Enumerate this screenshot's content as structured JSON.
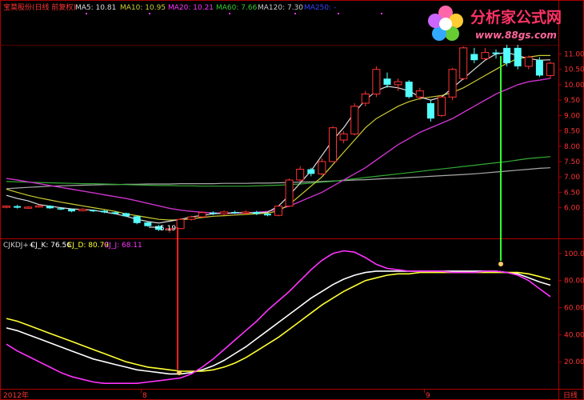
{
  "header": {
    "stock": "宝莫股份(日线 前复权)",
    "ma5": "MA5: 10.81",
    "ma10": "MA10: 10.95",
    "ma20": "MA20: 10.21",
    "ma60": "MA60: 7.66",
    "ma120": "MA120: 7.30",
    "ma250": "MA250: -"
  },
  "watermark": {
    "brand": "分析家公式网",
    "url": "www.88gs.com"
  },
  "indicator": {
    "name": "CJKDJ++",
    "k": "CJ_K: 76.56",
    "d": "CJ_D: 80.79",
    "j": "CJ_J: 68.11"
  },
  "price_axis": [
    "11.00",
    "10.50",
    "10.00",
    "9.50",
    "9.00",
    "8.50",
    "8.00",
    "7.50",
    "7.00",
    "6.50",
    "6.00"
  ],
  "ind_axis": [
    "100.00",
    "80.00",
    "60.00",
    "40.00",
    "20.00"
  ],
  "time_axis": {
    "left": "2012年",
    "m1": "8",
    "m2": "9",
    "mode": "日线"
  },
  "low_label": "5.19",
  "colors": {
    "up": "#ff3333",
    "down": "#54ffff",
    "ma5": "#dddddd",
    "ma10": "#cccc33",
    "ma20": "#cc33cc",
    "ma60": "#33aa33",
    "ma120": "#aaaaaa",
    "k": "#ffffff",
    "d": "#ffff33",
    "j": "#ff33ff",
    "frame": "#aa0000"
  },
  "chart_data": [
    {
      "type": "candlestick",
      "ylim": [
        5.0,
        11.3
      ],
      "candles": [
        [
          6.02,
          6.05,
          6.08,
          5.98
        ],
        [
          6.05,
          6.0,
          6.09,
          5.97
        ],
        [
          6.0,
          6.02,
          6.05,
          5.96
        ],
        [
          6.02,
          6.06,
          6.1,
          6.0
        ],
        [
          6.06,
          5.98,
          6.08,
          5.96
        ],
        [
          5.98,
          5.95,
          6.02,
          5.92
        ],
        [
          5.95,
          5.88,
          5.97,
          5.85
        ],
        [
          5.9,
          5.95,
          5.98,
          5.88
        ],
        [
          5.92,
          5.9,
          5.94,
          5.86
        ],
        [
          5.9,
          5.85,
          5.92,
          5.82
        ],
        [
          5.85,
          5.8,
          5.88,
          5.78
        ],
        [
          5.82,
          5.72,
          5.84,
          5.7
        ],
        [
          5.72,
          5.5,
          5.74,
          5.46
        ],
        [
          5.52,
          5.4,
          5.55,
          5.38
        ],
        [
          5.4,
          5.28,
          5.44,
          5.24
        ],
        [
          5.28,
          5.32,
          5.36,
          5.19
        ],
        [
          5.32,
          5.62,
          5.66,
          5.3
        ],
        [
          5.62,
          5.7,
          5.74,
          5.58
        ],
        [
          5.7,
          5.84,
          5.88,
          5.68
        ],
        [
          5.84,
          5.8,
          5.88,
          5.76
        ],
        [
          5.8,
          5.86,
          5.9,
          5.76
        ],
        [
          5.86,
          5.82,
          5.9,
          5.8
        ],
        [
          5.82,
          5.86,
          5.92,
          5.78
        ],
        [
          5.86,
          5.8,
          5.9,
          5.76
        ],
        [
          5.8,
          5.75,
          5.84,
          5.72
        ],
        [
          5.75,
          6.05,
          6.08,
          5.72
        ],
        [
          6.05,
          6.9,
          6.95,
          6.02
        ],
        [
          6.9,
          7.25,
          7.35,
          6.85
        ],
        [
          7.25,
          7.1,
          7.3,
          7.02
        ],
        [
          7.1,
          7.5,
          7.6,
          7.05
        ],
        [
          7.5,
          8.6,
          8.65,
          7.48
        ],
        [
          8.2,
          8.4,
          8.5,
          8.1
        ],
        [
          8.4,
          9.3,
          9.4,
          8.35
        ],
        [
          9.4,
          9.7,
          9.8,
          9.3
        ],
        [
          9.7,
          10.5,
          10.6,
          9.6
        ],
        [
          10.2,
          10.0,
          10.4,
          9.9
        ],
        [
          10.0,
          10.1,
          10.2,
          9.8
        ],
        [
          10.1,
          9.6,
          10.15,
          9.55
        ],
        [
          9.6,
          9.8,
          9.9,
          9.5
        ],
        [
          9.4,
          8.9,
          9.5,
          8.8
        ],
        [
          9.0,
          9.6,
          9.65,
          8.95
        ],
        [
          9.6,
          10.5,
          10.55,
          9.5
        ],
        [
          10.2,
          11.2,
          11.25,
          10.15
        ],
        [
          11.0,
          10.8,
          11.2,
          10.7
        ],
        [
          10.85,
          11.05,
          11.2,
          10.8
        ],
        [
          11.05,
          11.0,
          11.15,
          10.85
        ],
        [
          11.2,
          10.7,
          11.3,
          10.6
        ],
        [
          11.2,
          10.6,
          11.3,
          10.5
        ],
        [
          10.6,
          10.9,
          10.95,
          10.5
        ],
        [
          10.8,
          10.3,
          10.9,
          10.25
        ],
        [
          10.3,
          10.7,
          10.75,
          10.2
        ]
      ],
      "ma5": [
        6.4,
        6.3,
        6.22,
        6.1,
        6.05,
        6.0,
        5.96,
        5.94,
        5.92,
        5.86,
        5.8,
        5.72,
        5.62,
        5.55,
        5.5,
        5.56,
        5.62,
        5.7,
        5.75,
        5.8,
        5.82,
        5.83,
        5.84,
        5.83,
        5.85,
        6.05,
        6.4,
        6.8,
        7.2,
        7.7,
        8.2,
        8.6,
        9.1,
        9.5,
        9.8,
        9.95,
        9.9,
        9.8,
        9.6,
        9.5,
        9.6,
        9.9,
        10.2,
        10.5,
        10.8,
        11.0,
        11.05,
        10.95,
        10.85,
        10.8,
        10.81
      ],
      "ma10": [
        6.6,
        6.5,
        6.4,
        6.32,
        6.25,
        6.18,
        6.12,
        6.06,
        6.0,
        5.94,
        5.88,
        5.8,
        5.74,
        5.68,
        5.62,
        5.6,
        5.6,
        5.64,
        5.68,
        5.72,
        5.74,
        5.76,
        5.78,
        5.8,
        5.82,
        5.9,
        6.1,
        6.4,
        6.7,
        7.0,
        7.4,
        7.8,
        8.2,
        8.6,
        8.9,
        9.1,
        9.3,
        9.45,
        9.55,
        9.6,
        9.65,
        9.75,
        9.9,
        10.1,
        10.3,
        10.5,
        10.7,
        10.85,
        10.9,
        10.95,
        10.95
      ],
      "ma20": [
        6.95,
        6.9,
        6.84,
        6.78,
        6.72,
        6.66,
        6.6,
        6.54,
        6.48,
        6.42,
        6.36,
        6.3,
        6.22,
        6.14,
        6.06,
        5.98,
        5.92,
        5.88,
        5.85,
        5.83,
        5.82,
        5.82,
        5.83,
        5.85,
        5.88,
        5.95,
        6.05,
        6.2,
        6.35,
        6.5,
        6.7,
        6.9,
        7.1,
        7.3,
        7.55,
        7.8,
        8.05,
        8.25,
        8.45,
        8.6,
        8.75,
        8.9,
        9.1,
        9.3,
        9.5,
        9.7,
        9.85,
        10.0,
        10.1,
        10.15,
        10.21
      ],
      "ma60": [
        6.85,
        6.84,
        6.83,
        6.82,
        6.81,
        6.8,
        6.79,
        6.78,
        6.78,
        6.77,
        6.76,
        6.75,
        6.74,
        6.73,
        6.72,
        6.72,
        6.71,
        6.71,
        6.7,
        6.7,
        6.7,
        6.7,
        6.7,
        6.71,
        6.72,
        6.73,
        6.75,
        6.77,
        6.8,
        6.83,
        6.86,
        6.9,
        6.94,
        6.98,
        7.02,
        7.06,
        7.1,
        7.14,
        7.18,
        7.22,
        7.26,
        7.3,
        7.34,
        7.38,
        7.42,
        7.46,
        7.5,
        7.55,
        7.6,
        7.63,
        7.66
      ],
      "ma120": [
        6.62,
        6.64,
        6.66,
        6.68,
        6.7,
        6.71,
        6.72,
        6.73,
        6.74,
        6.75,
        6.75,
        6.76,
        6.76,
        6.77,
        6.77,
        6.77,
        6.78,
        6.78,
        6.78,
        6.78,
        6.79,
        6.79,
        6.79,
        6.8,
        6.8,
        6.81,
        6.82,
        6.83,
        6.84,
        6.85,
        6.87,
        6.88,
        6.9,
        6.91,
        6.93,
        6.95,
        6.96,
        6.98,
        7.0,
        7.02,
        7.04,
        7.06,
        7.08,
        7.1,
        7.13,
        7.16,
        7.19,
        7.22,
        7.25,
        7.28,
        7.3
      ]
    },
    {
      "type": "line",
      "ylim": [
        0,
        110
      ],
      "series": [
        {
          "name": "CJ_K",
          "values": [
            45,
            43,
            40,
            37,
            34,
            31,
            28,
            25,
            22,
            20,
            18,
            16,
            14,
            13,
            12,
            11,
            11,
            12,
            14,
            17,
            21,
            26,
            31,
            37,
            43,
            49,
            55,
            61,
            67,
            72,
            77,
            81,
            84,
            86,
            87,
            87,
            87,
            87,
            87,
            87,
            87,
            87,
            87,
            87,
            87,
            87,
            86,
            85,
            82,
            79,
            76.56
          ]
        },
        {
          "name": "CJ_D",
          "values": [
            52,
            50,
            47,
            44,
            41,
            38,
            35,
            32,
            29,
            26,
            23,
            20,
            18,
            16,
            15,
            14,
            13,
            13,
            13,
            14,
            16,
            19,
            23,
            28,
            33,
            38,
            44,
            50,
            56,
            62,
            67,
            72,
            76,
            80,
            82,
            84,
            85,
            85,
            86,
            86,
            86,
            86,
            86,
            86,
            86,
            86,
            86,
            86,
            85,
            83,
            80.79
          ]
        },
        {
          "name": "CJ_J",
          "values": [
            33,
            28,
            24,
            20,
            16,
            12,
            9,
            7,
            5,
            4,
            4,
            4,
            4,
            5,
            6,
            7,
            8,
            11,
            16,
            22,
            29,
            36,
            43,
            50,
            58,
            65,
            72,
            80,
            88,
            95,
            100,
            102,
            101,
            97,
            92,
            89,
            88,
            87,
            87,
            87,
            87,
            86,
            86,
            86,
            87,
            87,
            86,
            84,
            80,
            74,
            68.11
          ]
        }
      ]
    }
  ]
}
